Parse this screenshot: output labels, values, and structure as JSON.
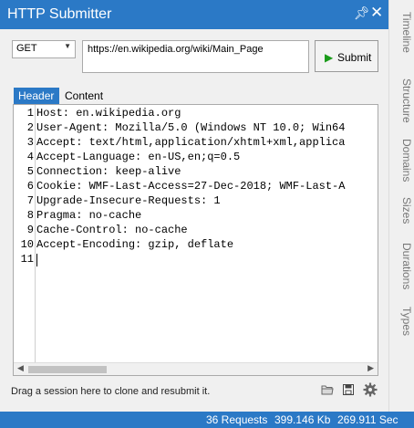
{
  "window": {
    "title": "HTTP Submitter",
    "pin_icon": "pin-icon",
    "close_icon": "close-icon"
  },
  "request": {
    "method": "GET",
    "url": "https://en.wikipedia.org/wiki/Main_Page",
    "submit_label": "Submit"
  },
  "tabs": {
    "header": "Header",
    "content": "Content"
  },
  "editor": {
    "lines": [
      {
        "num": "1",
        "text": "Host: en.wikipedia.org"
      },
      {
        "num": "2",
        "text": "User-Agent: Mozilla/5.0 (Windows NT 10.0; Win64"
      },
      {
        "num": "3",
        "text": "Accept: text/html,application/xhtml+xml,applica"
      },
      {
        "num": "4",
        "text": "Accept-Language: en-US,en;q=0.5"
      },
      {
        "num": "5",
        "text": "Connection: keep-alive"
      },
      {
        "num": "6",
        "text": "Cookie: WMF-Last-Access=27-Dec-2018; WMF-Last-A"
      },
      {
        "num": "7",
        "text": "Upgrade-Insecure-Requests: 1"
      },
      {
        "num": "8",
        "text": "Pragma: no-cache"
      },
      {
        "num": "9",
        "text": "Cache-Control: no-cache"
      },
      {
        "num": "10",
        "text": "Accept-Encoding: gzip, deflate"
      },
      {
        "num": "11",
        "text": ""
      }
    ]
  },
  "footer": {
    "hint": "Drag a session here to clone and resubmit it."
  },
  "side_tabs": [
    "Timeline",
    "Structure",
    "Domains",
    "Sizes",
    "Durations",
    "Types"
  ],
  "status": {
    "requests": "36 Requests",
    "size": "399.146 Kb",
    "time": "269.911 Sec"
  },
  "colors": {
    "accent": "#2b79c6",
    "submit_play": "#1a9b1a"
  }
}
